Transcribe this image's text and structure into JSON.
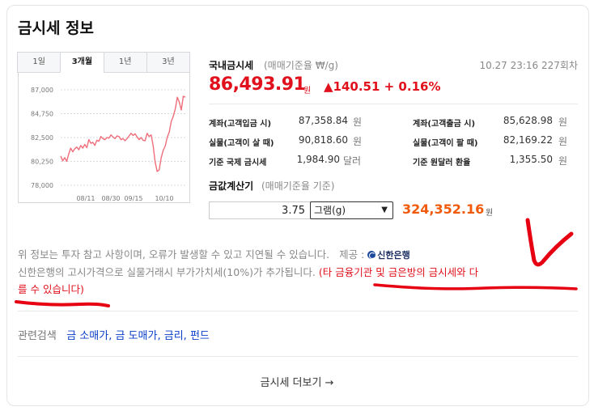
{
  "title": "금시세 정보",
  "chart": {
    "tabs": [
      {
        "label": "1일"
      },
      {
        "label": "3개월"
      },
      {
        "label": "1년"
      },
      {
        "label": "3년"
      }
    ],
    "active_tab": 1
  },
  "chart_data": {
    "type": "line",
    "title": "",
    "xlabel": "",
    "ylabel": "",
    "y_ticks": [
      "87,000",
      "84,750",
      "82,500",
      "80,250",
      "78,000"
    ],
    "y_tick_values": [
      87000,
      84750,
      82500,
      80250,
      78000
    ],
    "x_ticks": [
      "08/11",
      "08/30",
      "09/15",
      "10/10"
    ],
    "ylim": [
      78000,
      87000
    ],
    "grid": "horizontal-dotted",
    "legend": "none",
    "line_color": "#f06d7a",
    "values": [
      80750,
      80300,
      80600,
      80250,
      80950,
      81500,
      81150,
      81450,
      81600,
      81350,
      81750,
      81500,
      81850,
      81550,
      82300,
      81950,
      82050,
      81750,
      82250,
      82150,
      82600,
      82400,
      82300,
      82500,
      82450,
      82750,
      82550,
      82400,
      82650,
      82600,
      82300,
      82400,
      82200,
      82400,
      82650,
      82900,
      82700,
      82850,
      82550,
      82300,
      82500,
      82250,
      82200,
      82900,
      82600,
      82750,
      81700,
      80200,
      79300,
      79450,
      80600,
      81300,
      81700,
      82500,
      83000,
      84000,
      84500,
      85200,
      86300,
      85850,
      85100,
      86400,
      86300
    ]
  },
  "price": {
    "label": "국내금시세",
    "unit": "(매매기준율 ₩/g)",
    "time": "10.27 23:16 227회차",
    "value": "86,493.91",
    "won": "원",
    "change": "▲140.51 + 0.16%",
    "color": "#e0101c"
  },
  "rows": [
    {
      "label": "계좌(고객입금 시)",
      "value": "87,358.84",
      "unit": "원"
    },
    {
      "label": "계좌(고객출금 시)",
      "value": "85,628.98",
      "unit": "원"
    },
    {
      "label": "실물(고객이 살 때)",
      "value": "90,818.60",
      "unit": "원"
    },
    {
      "label": "실물(고객이 팔 때)",
      "value": "82,169.22",
      "unit": "원"
    },
    {
      "label": "기준 국제 금시세",
      "value": "1,984.90",
      "unit": "달러"
    },
    {
      "label": "기준 원달러 환율",
      "value": "1,355.50",
      "unit": "원"
    }
  ],
  "calculator": {
    "label": "금값계산기",
    "sub": "(매매기준율 기준)",
    "amount": "3.75",
    "unit_select": "그램(g)",
    "result": "324,352.16",
    "won": "원",
    "result_color": "#f05a0a"
  },
  "notice": {
    "line1": "위 정보는 투자 참고 사항이며, 오류가 발생할 수 있고 지연될 수 있습니다.",
    "provider_label": "제공 :",
    "provider_name": "신한은행",
    "line2_a": "신한은행의 고시가격으로 실물거래시 부가가치세(10%)가 추가됩니다. ",
    "line2_red_a": "(타 금융기관 및 금은방의 금시세와 다",
    "line2_red_b": "를 수 있습니다",
    "line2_end": ")"
  },
  "related": {
    "label": "관련검색",
    "links": [
      {
        "text": "금 소매가,"
      },
      {
        "text": "금 도매가,"
      },
      {
        "text": "금리,"
      },
      {
        "text": "펀드"
      }
    ]
  },
  "more": {
    "label": "금시세 더보기 →"
  },
  "annotation_color": "#e60012"
}
